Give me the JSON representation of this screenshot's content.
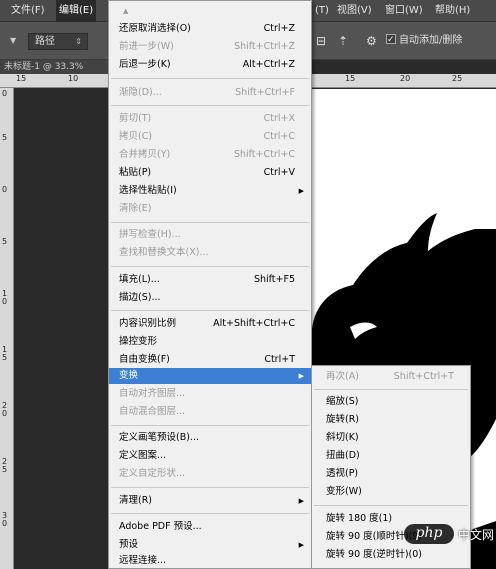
{
  "menubar": {
    "file": "文件(F)",
    "edit": "编辑(E)",
    "filter_partial": "(T)",
    "view": "视图(V)",
    "window": "窗口(W)",
    "help": "帮助(H)"
  },
  "options_bar": {
    "path_mode": "路径",
    "auto_add_delete": "自动添加/删除"
  },
  "document": {
    "tab_title": "未标题-1 @ 33.3%"
  },
  "ruler": {
    "h_ticks": [
      "15",
      "10",
      "15",
      "20",
      "25"
    ],
    "v_ticks": [
      "0",
      "5",
      "0",
      "5",
      "1 0",
      "1 5",
      "2 0",
      "2 5",
      "3 0"
    ]
  },
  "edit_menu": {
    "top_arrow": "▲",
    "items": [
      {
        "label": "还原取消选择(O)",
        "shortcut": "Ctrl+Z",
        "enabled": true
      },
      {
        "label": "前进一步(W)",
        "shortcut": "Shift+Ctrl+Z",
        "enabled": false
      },
      {
        "label": "后退一步(K)",
        "shortcut": "Alt+Ctrl+Z",
        "enabled": true
      },
      {
        "label": "渐隐(D)...",
        "shortcut": "Shift+Ctrl+F",
        "enabled": false
      },
      {
        "label": "剪切(T)",
        "shortcut": "Ctrl+X",
        "enabled": false
      },
      {
        "label": "拷贝(C)",
        "shortcut": "Ctrl+C",
        "enabled": false
      },
      {
        "label": "合并拷贝(Y)",
        "shortcut": "Shift+Ctrl+C",
        "enabled": false
      },
      {
        "label": "粘贴(P)",
        "shortcut": "Ctrl+V",
        "enabled": true
      },
      {
        "label": "选择性粘贴(I)",
        "shortcut": "",
        "enabled": true,
        "submenu": true
      },
      {
        "label": "清除(E)",
        "shortcut": "",
        "enabled": false
      },
      {
        "label": "拼写检查(H)...",
        "shortcut": "",
        "enabled": false
      },
      {
        "label": "查找和替换文本(X)...",
        "shortcut": "",
        "enabled": false
      },
      {
        "label": "填充(L)...",
        "shortcut": "Shift+F5",
        "enabled": true
      },
      {
        "label": "描边(S)...",
        "shortcut": "",
        "enabled": true
      },
      {
        "label": "内容识别比例",
        "shortcut": "Alt+Shift+Ctrl+C",
        "enabled": true
      },
      {
        "label": "操控变形",
        "shortcut": "",
        "enabled": true
      },
      {
        "label": "自由变换(F)",
        "shortcut": "Ctrl+T",
        "enabled": true
      },
      {
        "label": "变换",
        "shortcut": "",
        "enabled": true,
        "submenu": true,
        "highlighted": true
      },
      {
        "label": "自动对齐图层...",
        "shortcut": "",
        "enabled": false
      },
      {
        "label": "自动混合图层...",
        "shortcut": "",
        "enabled": false
      },
      {
        "label": "定义画笔预设(B)...",
        "shortcut": "",
        "enabled": true
      },
      {
        "label": "定义图案...",
        "shortcut": "",
        "enabled": true
      },
      {
        "label": "定义自定形状...",
        "shortcut": "",
        "enabled": false
      },
      {
        "label": "清理(R)",
        "shortcut": "",
        "enabled": true,
        "submenu": true
      },
      {
        "label": "Adobe PDF 预设...",
        "shortcut": "",
        "enabled": true
      },
      {
        "label": "预设",
        "shortcut": "",
        "enabled": true,
        "submenu": true
      },
      {
        "label": "远程连接...",
        "shortcut": "",
        "enabled": true
      }
    ]
  },
  "transform_submenu": {
    "items": [
      {
        "label": "再次(A)",
        "shortcut": "Shift+Ctrl+T",
        "enabled": false
      },
      {
        "label": "缩放(S)",
        "enabled": true
      },
      {
        "label": "旋转(R)",
        "enabled": true
      },
      {
        "label": "斜切(K)",
        "enabled": true
      },
      {
        "label": "扭曲(D)",
        "enabled": true
      },
      {
        "label": "透视(P)",
        "enabled": true
      },
      {
        "label": "变形(W)",
        "enabled": true
      },
      {
        "label": "旋转 180 度(1)",
        "enabled": true
      },
      {
        "label": "旋转 90 度(顺时针)(9)",
        "enabled": true
      },
      {
        "label": "旋转 90 度(逆时针)(0)",
        "enabled": true
      }
    ]
  },
  "watermark": {
    "brand": "php",
    "site": "中文网"
  },
  "colors": {
    "highlight": "#3c7fd4",
    "menu_bg": "#f0f0f0",
    "menubar_bg": "#4a4a4a",
    "workspace_bg": "#2a2a2a"
  }
}
